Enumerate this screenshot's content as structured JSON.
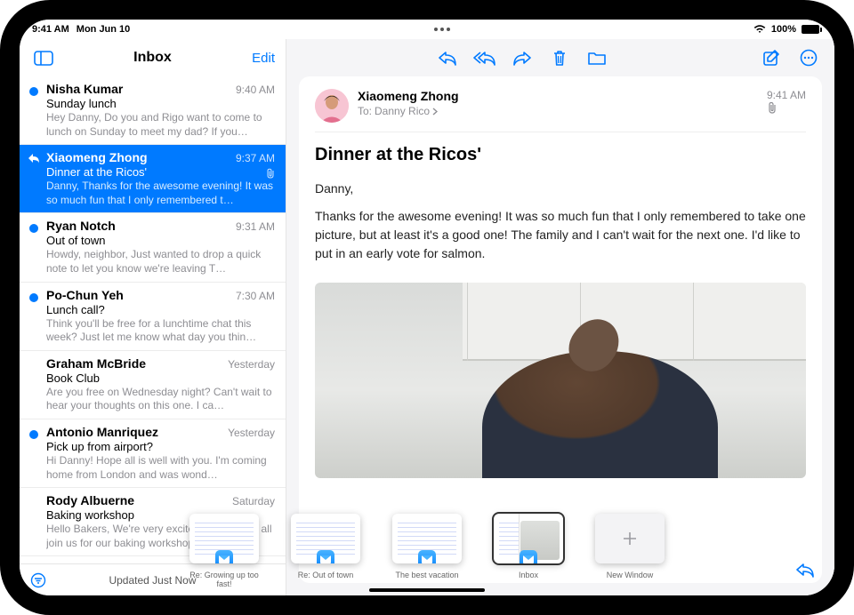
{
  "status": {
    "time": "9:41 AM",
    "date": "Mon Jun 10",
    "battery": "100%"
  },
  "sidebar": {
    "title": "Inbox",
    "edit_label": "Edit",
    "footer": "Updated Just Now"
  },
  "messages": [
    {
      "sender": "Nisha Kumar",
      "time": "9:40 AM",
      "subject": "Sunday lunch",
      "preview": "Hey Danny, Do you and Rigo want to come to lunch on Sunday to meet my dad? If you…",
      "unread": true
    },
    {
      "sender": "Xiaomeng Zhong",
      "time": "9:37 AM",
      "subject": "Dinner at the Ricos'",
      "preview": "Danny, Thanks for the awesome evening! It was so much fun that I only remembered t…",
      "selected": true,
      "replied": true,
      "attachment": true
    },
    {
      "sender": "Ryan Notch",
      "time": "9:31 AM",
      "subject": "Out of town",
      "preview": "Howdy, neighbor, Just wanted to drop a quick note to let you know we're leaving T…",
      "unread": true
    },
    {
      "sender": "Po-Chun Yeh",
      "time": "7:30 AM",
      "subject": "Lunch call?",
      "preview": "Think you'll be free for a lunchtime chat this week? Just let me know what day you thin…",
      "unread": true
    },
    {
      "sender": "Graham McBride",
      "time": "Yesterday",
      "subject": "Book Club",
      "preview": "Are you free on Wednesday night? Can't wait to hear your thoughts on this one. I ca…"
    },
    {
      "sender": "Antonio Manriquez",
      "time": "Yesterday",
      "subject": "Pick up from airport?",
      "preview": "Hi Danny! Hope all is well with you. I'm coming home from London and was wond…",
      "unread": true
    },
    {
      "sender": "Rody Albuerne",
      "time": "Saturday",
      "subject": "Baking workshop",
      "preview": "Hello Bakers, We're very excited to have you all join us for our baking workshop…"
    }
  ],
  "viewer": {
    "sender": "Xiaomeng Zhong",
    "to_label": "To:",
    "recipient": "Danny Rico",
    "time": "9:41 AM",
    "title": "Dinner at the Ricos'",
    "greeting": "Danny,",
    "body": "Thanks for the awesome evening! It was so much fun that I only remembered to take one picture, but at least it's a good one! The family and I can't wait for the next one. I'd like to put in an early vote for salmon."
  },
  "shelf": [
    {
      "label": "Re: Growing up too fast!",
      "kind": "compose"
    },
    {
      "label": "Re: Out of town",
      "kind": "compose"
    },
    {
      "label": "The best vacation",
      "kind": "compose"
    },
    {
      "label": "Inbox",
      "kind": "split",
      "selected": true
    },
    {
      "label": "New Window",
      "kind": "new"
    }
  ]
}
